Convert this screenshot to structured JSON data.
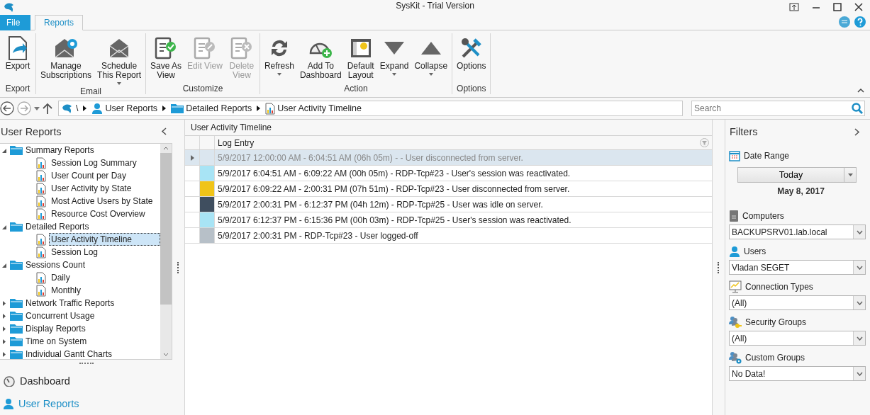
{
  "window": {
    "title": "SysKit - Trial Version"
  },
  "ribbon_tabs": [
    {
      "label": "File",
      "kind": "file",
      "selected": false
    },
    {
      "label": "Reports",
      "kind": "tab",
      "selected": true
    }
  ],
  "ribbon": {
    "groups": [
      {
        "label": "Export",
        "buttons": [
          {
            "label": "Export",
            "kind": "export",
            "disabled": false,
            "dropdown": false
          }
        ]
      },
      {
        "label": "Email",
        "buttons": [
          {
            "label": "Manage\nSubscriptions",
            "kind": "mail-gear",
            "disabled": false,
            "dropdown": false
          },
          {
            "label": "Schedule\nThis Report",
            "kind": "mail",
            "disabled": false,
            "dropdown": true
          }
        ]
      },
      {
        "label": "Customize",
        "buttons": [
          {
            "label": "Save As\nView",
            "kind": "doc-check",
            "disabled": false,
            "dropdown": false
          },
          {
            "label": "Edit View",
            "kind": "doc-pencil",
            "disabled": true,
            "dropdown": false
          },
          {
            "label": "Delete\nView",
            "kind": "doc-x",
            "disabled": true,
            "dropdown": false
          }
        ]
      },
      {
        "label": "Action",
        "buttons": [
          {
            "label": "Refresh",
            "kind": "refresh",
            "disabled": false,
            "dropdown": true
          },
          {
            "label": "Add To\nDashboard",
            "kind": "gauge-plus",
            "disabled": false,
            "dropdown": false
          },
          {
            "label": "Default\nLayout",
            "kind": "layout",
            "disabled": false,
            "dropdown": false
          },
          {
            "label": "Expand",
            "kind": "tri-down",
            "disabled": false,
            "dropdown": true
          },
          {
            "label": "Collapse",
            "kind": "tri-up",
            "disabled": false,
            "dropdown": true
          }
        ]
      },
      {
        "label": "Options",
        "buttons": [
          {
            "label": "Options",
            "kind": "tools",
            "disabled": false,
            "dropdown": false
          }
        ]
      }
    ]
  },
  "navigation": {
    "breadcrumb": [
      {
        "label": "\\",
        "kind": "logo"
      },
      {
        "label": "User Reports",
        "kind": "user"
      },
      {
        "label": "Detailed Reports",
        "kind": "folder"
      },
      {
        "label": "User Activity Timeline",
        "kind": "report"
      }
    ],
    "search": {
      "placeholder": "Search"
    }
  },
  "left_panel": {
    "title": "User Reports",
    "tree": [
      {
        "label": "Summary Reports",
        "kind": "folder",
        "expanded": true,
        "children": [
          {
            "label": "Session Log Summary",
            "kind": "report",
            "selected": false
          },
          {
            "label": "User Count per Day",
            "kind": "report",
            "selected": false
          },
          {
            "label": "User Activity by State",
            "kind": "report",
            "selected": false
          },
          {
            "label": "Most Active Users by State",
            "kind": "report",
            "selected": false
          },
          {
            "label": "Resource Cost Overview",
            "kind": "report",
            "selected": false
          }
        ]
      },
      {
        "label": "Detailed Reports",
        "kind": "folder",
        "expanded": true,
        "children": [
          {
            "label": "User Activity Timeline",
            "kind": "report",
            "selected": true
          },
          {
            "label": "Session Log",
            "kind": "report",
            "selected": false
          }
        ]
      },
      {
        "label": "Sessions Count",
        "kind": "folder",
        "expanded": true,
        "children": [
          {
            "label": "Daily",
            "kind": "report",
            "selected": false
          },
          {
            "label": "Monthly",
            "kind": "report",
            "selected": false
          }
        ]
      },
      {
        "label": "Network Traffic Reports",
        "kind": "folder",
        "expanded": false
      },
      {
        "label": "Concurrent Usage",
        "kind": "folder",
        "expanded": false
      },
      {
        "label": "Display Reports",
        "kind": "folder",
        "expanded": false
      },
      {
        "label": "Time on System",
        "kind": "folder",
        "expanded": false
      },
      {
        "label": "Individual Gantt Charts",
        "kind": "folder",
        "expanded": false
      }
    ],
    "nav_items": [
      {
        "label": "Dashboard",
        "kind": "gauge",
        "selected": false
      },
      {
        "label": "User Reports",
        "kind": "user",
        "selected": true
      }
    ]
  },
  "content": {
    "title": "User Activity Timeline",
    "table": {
      "columns": [
        "Log Entry"
      ],
      "rows": [
        {
          "text": "5/9/2017 12:00:00 AM - 6:04:51 AM (06h 05m) -  - User disconnected from server.",
          "selected": true
        },
        {
          "text": "5/9/2017 6:04:51 AM - 6:09:22 AM (00h 05m) - RDP-Tcp#23 - User's session was reactivated.",
          "color": "#a8e4f5",
          "selected": false
        },
        {
          "text": "5/9/2017 6:09:22 AM - 2:00:31 PM (07h 51m) - RDP-Tcp#23 - User disconnected from server.",
          "color": "#f0c419",
          "selected": false
        },
        {
          "text": "5/9/2017 2:00:31 PM - 6:12:37 PM (04h 12m) - RDP-Tcp#25 - User was idle on server.",
          "color": "#3f4e5f",
          "selected": false
        },
        {
          "text": "5/9/2017 6:12:37 PM - 6:15:36 PM (00h 03m) - RDP-Tcp#25 - User's session was reactivated.",
          "color": "#a8e4f5",
          "selected": false
        },
        {
          "text": "5/9/2017 2:00:31 PM - RDP-Tcp#23 - User logged-off",
          "color": "#b7c0c8",
          "selected": false
        }
      ]
    }
  },
  "filters": {
    "title": "Filters",
    "date_range": {
      "label": "Date Range",
      "button": "Today",
      "date": "May 8, 2017"
    },
    "fields": [
      {
        "label": "Computers",
        "kind": "computer",
        "value": "BACKUPSRV01.lab.local"
      },
      {
        "label": "Users",
        "kind": "user",
        "value": "Vladan SEGET"
      },
      {
        "label": "Connection Types",
        "kind": "monitor",
        "value": "(All)"
      },
      {
        "label": "Security Groups",
        "kind": "key-users",
        "value": "(All)"
      },
      {
        "label": "Custom Groups",
        "kind": "gear-users",
        "value": "No Data!"
      }
    ]
  }
}
